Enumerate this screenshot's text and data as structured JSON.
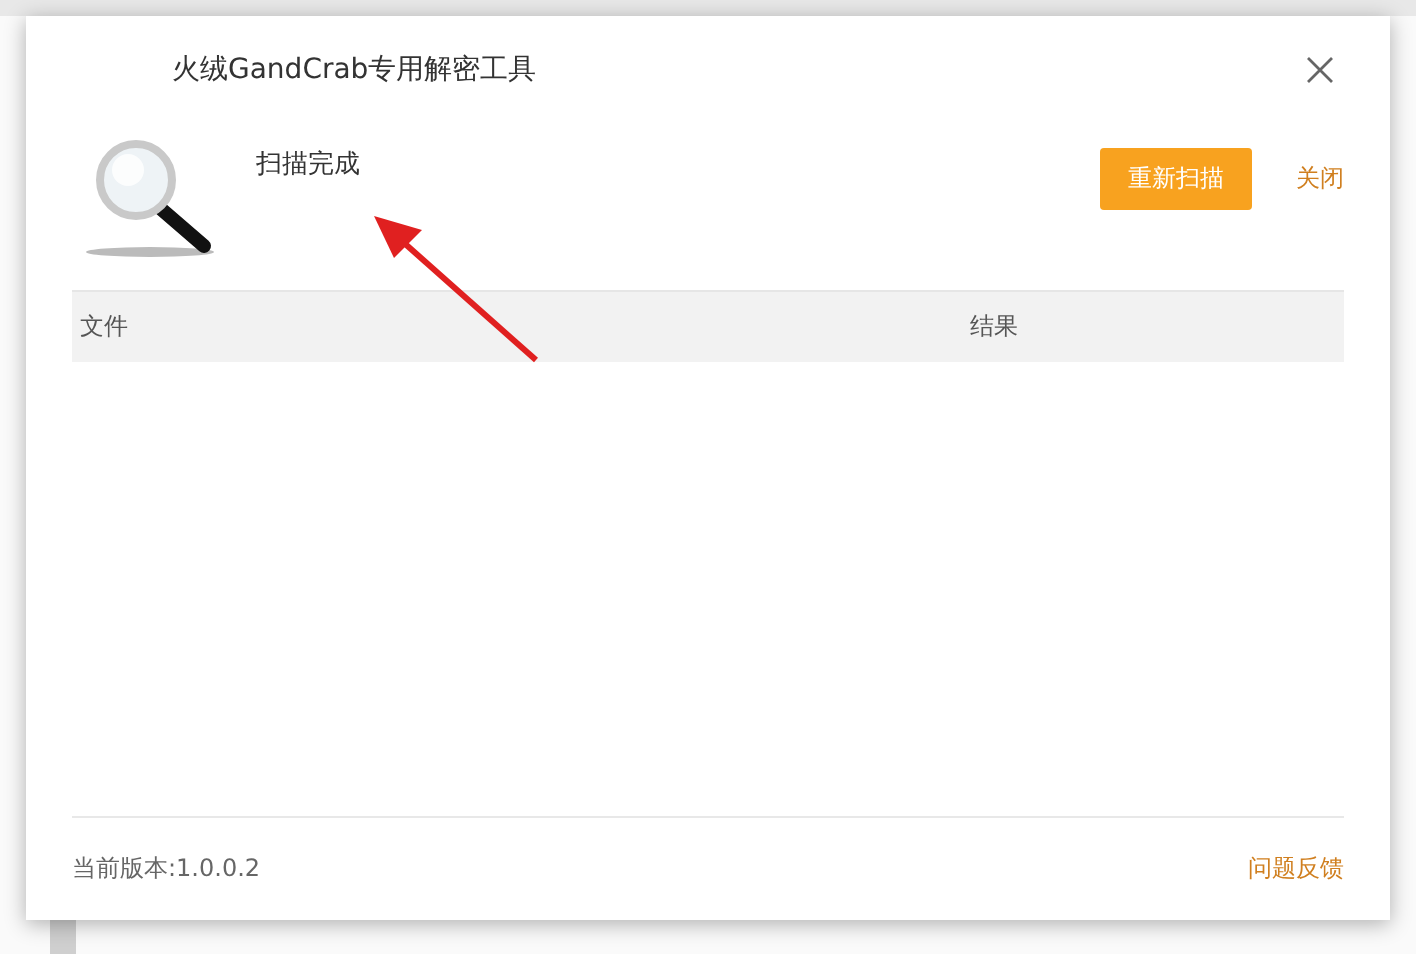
{
  "window": {
    "title": "火绒GandCrab专用解密工具"
  },
  "status": {
    "text": "扫描完成"
  },
  "actions": [
    {
      "kind": "primary",
      "label": "重新扫描"
    },
    {
      "kind": "link",
      "label": "关闭"
    }
  ],
  "table": {
    "columns": [
      "文件",
      "结果"
    ]
  },
  "footer": {
    "version": "当前版本:1.0.0.2",
    "feedback": "问题反馈"
  }
}
